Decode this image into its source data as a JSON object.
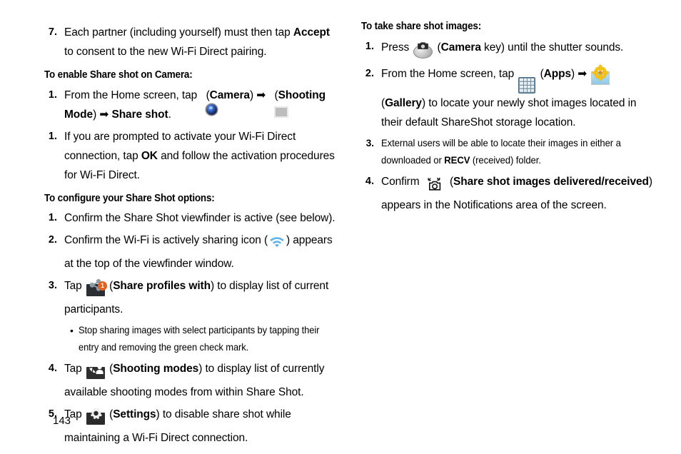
{
  "page": {
    "number": "143"
  },
  "left_column": {
    "blocks": [
      {
        "type": "item",
        "num": "7.",
        "lines": [
          "Each partner (including yourself) must then tap ",
          "Accept",
          " to consent to the new Wi-Fi Direct pairing."
        ]
      }
    ],
    "item7": {
      "num": "7.",
      "text_a": "Each partner (including yourself) must then tap ",
      "bold_a": "Accept",
      "text_b": " to consent to the new Wi-Fi Direct pairing."
    },
    "heading_enable": "To enable Share shot on Camera:",
    "item_enable_1": {
      "num": "1.",
      "text_a": "From the Home screen, tap ",
      "icon_camera": "camera-app-icon",
      "text_b": " (",
      "bold_camera": "Camera",
      "text_c": ") ➡ ",
      "icon_shooting_mode": "shooting-mode-icon",
      "text_d": " (",
      "bold_shooting_mode": "Shooting Mode",
      "text_e": ") ➡ ",
      "bold_share_shot": "Share shot",
      "text_f": "."
    },
    "item_enable_2": {
      "num": "1.",
      "text_a": "If you are prompted to activate your Wi-Fi Direct connection, tap ",
      "bold_ok": "OK",
      "text_b": " and follow the activation procedures for Wi-Fi Direct."
    },
    "heading_configure": "To configure your Share Shot options:",
    "item_cfg_1": {
      "num": "1.",
      "text": "Confirm the Share Shot viewfinder is active (see below)."
    },
    "item_cfg_2": {
      "num": "2.",
      "text_a": "Confirm the Wi-Fi is actively sharing icon (",
      "icon_wifi": "wifi-sharing-icon",
      "text_b": ") appears at the top of the viewfinder window."
    },
    "item_cfg_3": {
      "num": "3.",
      "text_a": "Tap ",
      "icon_share": "share-profiles-icon",
      "badge": "1",
      "text_b": " (",
      "bold": "Share profiles with",
      "text_c": ") to display list of current participants."
    },
    "bullet_cfg_3": "Stop sharing images with select participants by tapping their entry and removing the green check mark.",
    "item_cfg_4": {
      "num": "4.",
      "text_a": "Tap ",
      "icon_modes": "shooting-modes-icon",
      "text_b": " (",
      "bold": "Shooting modes",
      "text_c": ") to display list of currently available shooting modes from within Share Shot."
    },
    "item_cfg_5": {
      "num": "5.",
      "text_a": "Tap ",
      "icon_settings": "settings-gear-icon",
      "text_b": " (",
      "bold": "Settings",
      "text_c": ") to disable share shot while maintaining a Wi-Fi Direct connection."
    }
  },
  "right_column": {
    "heading_take": "To take share shot images:",
    "item_take_1": {
      "num": "1.",
      "text_a": "Press ",
      "icon_camera_key": "camera-key-icon",
      "text_b": " (",
      "bold": "Camera",
      "text_c": " key) until the shutter sounds."
    },
    "item_take_2": {
      "num": "2.",
      "text_a": "From the Home screen, tap ",
      "icon_apps": "apps-grid-icon",
      "text_b": " (",
      "bold_apps": "Apps",
      "text_c": ") ➡ ",
      "icon_gallery": "gallery-icon",
      "text_d": " (",
      "bold_gallery": "Gallery",
      "text_e": ") to locate your newly shot images located in their default ShareShot storage location."
    },
    "item_take_3": {
      "num": "3.",
      "text_a": "External users will be able to locate their images in either a downloaded or ",
      "bold_recv": "RECV",
      "text_b": " (received) folder."
    },
    "item_take_4": {
      "num": "4.",
      "text_a": "Confirm ",
      "icon_delivered": "share-shot-delivered-icon",
      "text_b": " (",
      "bold": "Share shot images delivered/received",
      "text_c": ") appears in the Notifications area of the screen."
    }
  },
  "colors": {
    "wifi_blue": "#61B4E4",
    "badge_orange": "#E4601F",
    "share_glyph": "#8c9ba6",
    "apps_blue": "#6D8FA8",
    "gallery_yellow": "#F5C518"
  }
}
